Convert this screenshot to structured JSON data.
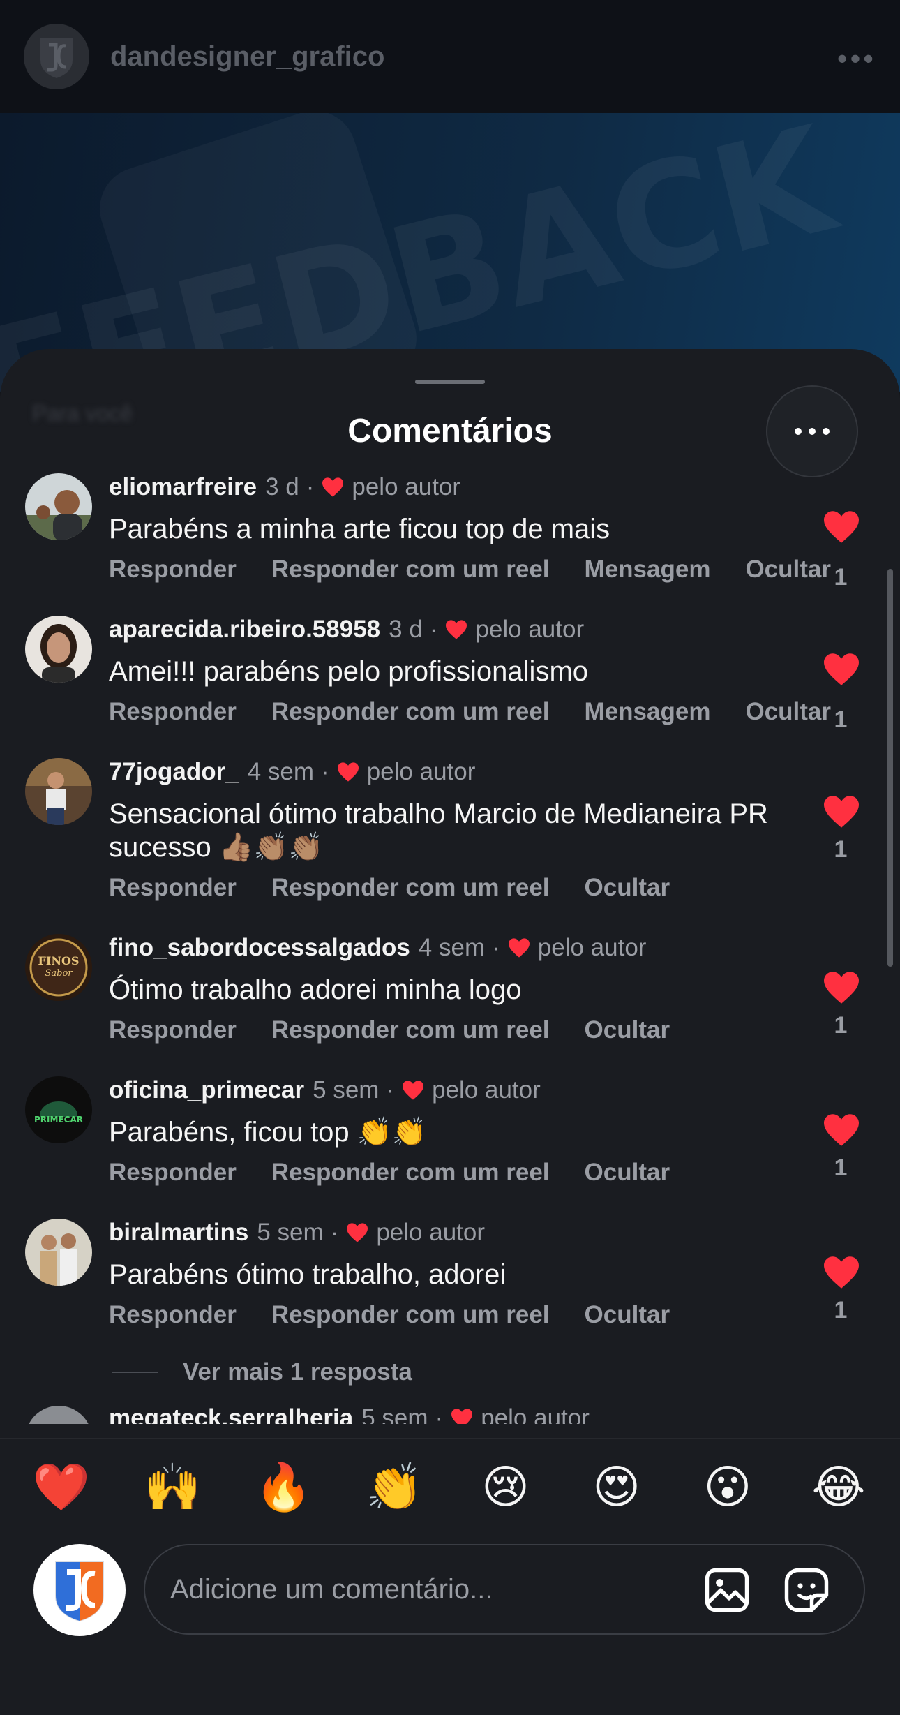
{
  "post_header": {
    "username": "dandesigner_grafico",
    "more": "•••",
    "hero_text": "FEEDBACK"
  },
  "sheet": {
    "title": "Comentários",
    "blurred_label": "Para você",
    "more_icon": "more-horizontal-icon"
  },
  "comments": [
    {
      "username": "eliomarfreire",
      "time": "3 d",
      "author_like": "pelo autor",
      "text": "Parabéns a minha arte ficou top de mais",
      "actions": [
        "Responder",
        "Responder com um reel",
        "Mensagem",
        "Ocultar"
      ],
      "likes": "1",
      "avatar_color": "#6b7a5c"
    },
    {
      "username": "aparecida.ribeiro.58958",
      "time": "3 d",
      "author_like": "pelo autor",
      "text": "Amei!!! parabéns pelo profissionalismo",
      "actions": [
        "Responder",
        "Responder com um reel",
        "Mensagem",
        "Ocultar"
      ],
      "likes": "1",
      "avatar_color": "#d8cfc6"
    },
    {
      "username": "77jogador_",
      "time": "4 sem",
      "author_like": "pelo autor",
      "text": "Sensacional ótimo trabalho Marcio de Medianeira PR sucesso 👍🏽👏🏽👏🏽",
      "actions": [
        "Responder",
        "Responder com um reel",
        "Ocultar"
      ],
      "likes": "1",
      "avatar_color": "#7a5a3a"
    },
    {
      "username": "fino_sabordocessalgados",
      "time": "4 sem",
      "author_like": "pelo autor",
      "text": "Ótimo trabalho adorei minha logo",
      "actions": [
        "Responder",
        "Responder com um reel",
        "Ocultar"
      ],
      "likes": "1",
      "avatar_color": "#3a2417"
    },
    {
      "username": "oficina_primecar",
      "time": "5 sem",
      "author_like": "pelo autor",
      "text": "Parabéns, ficou top 👏👏",
      "actions": [
        "Responder",
        "Responder com um reel",
        "Ocultar"
      ],
      "likes": "1",
      "avatar_color": "#0d0d0d"
    },
    {
      "username": "biralmartins",
      "time": "5 sem",
      "author_like": "pelo autor",
      "text": "Parabéns ótimo trabalho, adorei",
      "actions": [
        "Responder",
        "Responder com um reel",
        "Ocultar"
      ],
      "likes": "1",
      "avatar_color": "#b9a58a"
    }
  ],
  "view_more_replies": "Ver mais 1 resposta",
  "partial_comment": {
    "username": "megateck.serralheria",
    "time": "5 sem",
    "author_like": "pelo autor"
  },
  "reactions": [
    "❤️",
    "🙌",
    "🔥",
    "👏",
    "😢",
    "😍",
    "😮",
    "😂"
  ],
  "composer": {
    "placeholder": "Adicione um comentário...",
    "gallery_icon": "image-icon",
    "sticker_icon": "sticker-icon"
  },
  "colors": {
    "like_red": "#ff3040",
    "sheet_bg": "#1a1c21",
    "muted_text": "#9a9da4"
  }
}
